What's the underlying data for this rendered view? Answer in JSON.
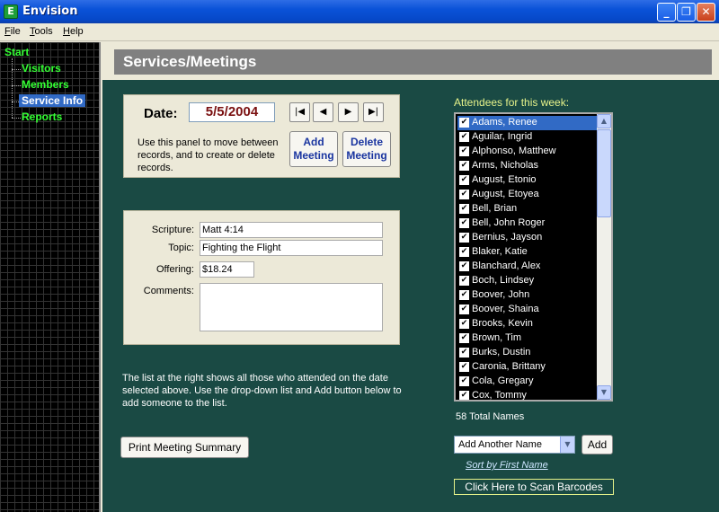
{
  "window": {
    "title": "Envision",
    "icon_letter": "E"
  },
  "menu": [
    "File",
    "Tools",
    "Help"
  ],
  "nav": {
    "root": "Start",
    "items": [
      "Visitors",
      "Members",
      "Service Info",
      "Reports"
    ],
    "selected": "Service Info"
  },
  "page": {
    "title": "Services/Meetings"
  },
  "meeting_panel": {
    "date_label": "Date:",
    "date_value": "5/5/2004",
    "help": "Use this panel to move between records, and to create or delete records.",
    "add_label": "Add Meeting",
    "delete_label": "Delete Meeting"
  },
  "details": {
    "scripture_label": "Scripture:",
    "scripture_value": "Matt 4:14",
    "topic_label": "Topic:",
    "topic_value": "Fighting the Flight",
    "offering_label": "Offering:",
    "offering_value": "$18.24",
    "comments_label": "Comments:",
    "comments_value": ""
  },
  "info_text": "The list at the right shows all those who attended on the date selected above.  Use the drop-down list and Add button below to add someone to the list.",
  "print_label": "Print Meeting Summary",
  "attendees": {
    "label": "Attendees for this week:",
    "names": [
      "Adams, Renee",
      "Aguilar, Ingrid",
      "Alphonso, Matthew",
      "Arms, Nicholas",
      "August, Etonio",
      "August, Etoyea",
      "Bell, Brian",
      "Bell, John Roger",
      "Bernius, Jayson",
      "Blaker, Katie",
      "Blanchard, Alex",
      "Boch, Lindsey",
      "Boover, John",
      "Boover, Shaina",
      "Brooks, Kevin",
      "Brown, Tim",
      "Burks, Dustin",
      "Caronia, Brittany",
      "Cola, Gregary",
      "Cox, Tommy"
    ],
    "total": "58 Total Names",
    "add_placeholder": "Add Another Name",
    "add_label": "Add",
    "sort_label": "Sort by First Name",
    "scan_label": "Click Here to Scan Barcodes"
  }
}
